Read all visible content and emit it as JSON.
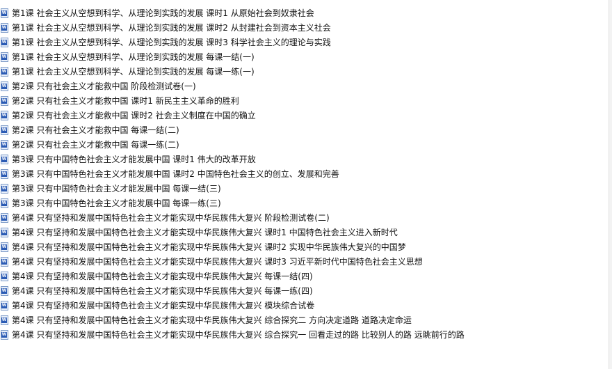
{
  "files": [
    {
      "name": "第1课 社会主义从空想到科学、从理论到实践的发展  课时1   从原始社会到奴隶社会",
      "icon": "word-document-icon"
    },
    {
      "name": "第1课 社会主义从空想到科学、从理论到实践的发展  课时2   从封建社会到资本主义社会",
      "icon": "word-document-icon"
    },
    {
      "name": "第1课 社会主义从空想到科学、从理论到实践的发展  课时3   科学社会主义的理论与实践",
      "icon": "word-document-icon"
    },
    {
      "name": "第1课 社会主义从空想到科学、从理论到实践的发展  每课一结(一)",
      "icon": "word-document-icon"
    },
    {
      "name": "第1课 社会主义从空想到科学、从理论到实践的发展  每课一练(一)",
      "icon": "word-document-icon"
    },
    {
      "name": "第2课 只有社会主义才能救中国  阶段检测试卷(一)",
      "icon": "word-document-icon"
    },
    {
      "name": "第2课 只有社会主义才能救中国  课时1   新民主主义革命的胜利",
      "icon": "word-document-icon"
    },
    {
      "name": "第2课 只有社会主义才能救中国  课时2   社会主义制度在中国的确立",
      "icon": "word-document-icon"
    },
    {
      "name": "第2课 只有社会主义才能救中国  每课一结(二)",
      "icon": "word-document-icon"
    },
    {
      "name": "第2课 只有社会主义才能救中国  每课一练(二)",
      "icon": "word-document-icon"
    },
    {
      "name": "第3课 只有中国特色社会主义才能发展中国  课时1   伟大的改革开放",
      "icon": "word-document-icon"
    },
    {
      "name": "第3课 只有中国特色社会主义才能发展中国  课时2   中国特色社会主义的创立、发展和完善",
      "icon": "word-document-icon"
    },
    {
      "name": "第3课 只有中国特色社会主义才能发展中国  每课一结(三)",
      "icon": "word-document-icon"
    },
    {
      "name": "第3课 只有中国特色社会主义才能发展中国  每课一练(三)",
      "icon": "word-document-icon"
    },
    {
      "name": "第4课 只有坚持和发展中国特色社会主义才能实现中华民族伟大复兴  阶段检测试卷(二)",
      "icon": "word-document-icon"
    },
    {
      "name": "第4课 只有坚持和发展中国特色社会主义才能实现中华民族伟大复兴  课时1   中国特色社会主义进入新时代",
      "icon": "word-document-icon"
    },
    {
      "name": "第4课 只有坚持和发展中国特色社会主义才能实现中华民族伟大复兴  课时2   实现中华民族伟大复兴的中国梦",
      "icon": "word-document-icon"
    },
    {
      "name": "第4课 只有坚持和发展中国特色社会主义才能实现中华民族伟大复兴  课时3   习近平新时代中国特色社会主义思想",
      "icon": "word-document-icon"
    },
    {
      "name": "第4课 只有坚持和发展中国特色社会主义才能实现中华民族伟大复兴  每课一结(四)",
      "icon": "word-document-icon"
    },
    {
      "name": "第4课 只有坚持和发展中国特色社会主义才能实现中华民族伟大复兴  每课一练(四)",
      "icon": "word-document-icon"
    },
    {
      "name": "第4课 只有坚持和发展中国特色社会主义才能实现中华民族伟大复兴  模块综合试卷",
      "icon": "word-document-icon"
    },
    {
      "name": "第4课 只有坚持和发展中国特色社会主义才能实现中华民族伟大复兴  综合探究二   方向决定道路   道路决定命运",
      "icon": "word-document-icon"
    },
    {
      "name": "第4课 只有坚持和发展中国特色社会主义才能实现中华民族伟大复兴  综合探究一   回看走过的路   比较别人的路   远眺前行的路",
      "icon": "word-document-icon"
    }
  ]
}
